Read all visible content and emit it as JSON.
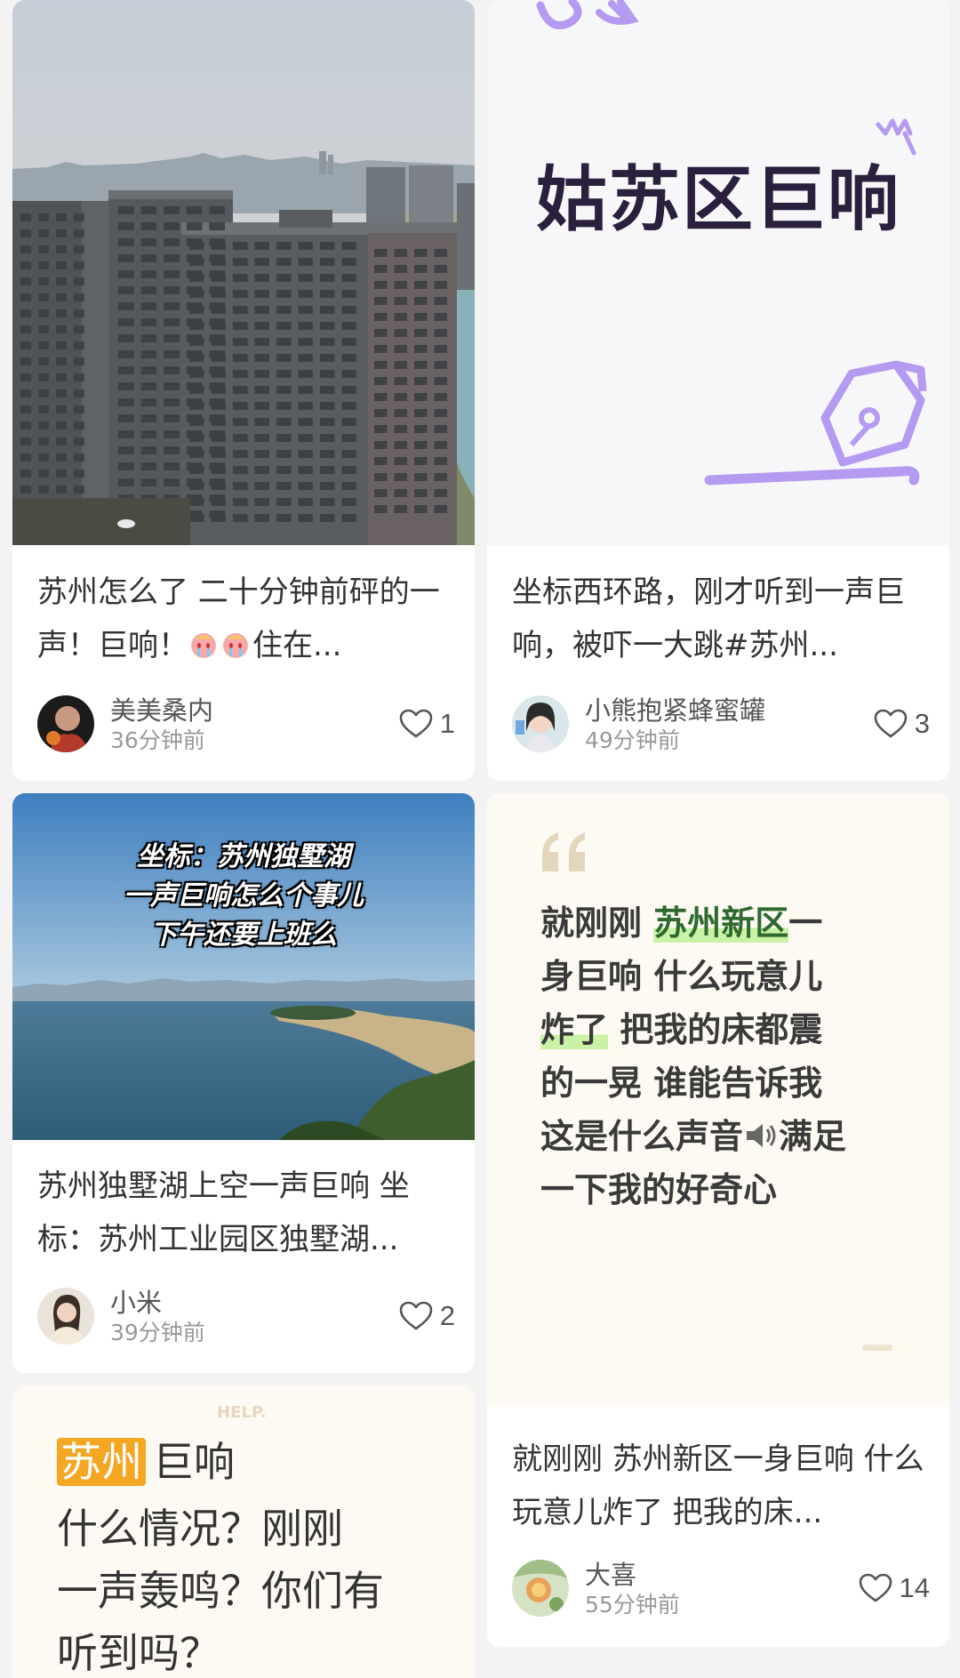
{
  "feed": [
    {
      "cover_kind": "photo-buildings",
      "caption_before": "苏州怎么了 二十分钟前砰的一声！巨响！",
      "caption_after": "住在...",
      "author": "美美桑内",
      "time": "36分钟前",
      "likes": "1"
    },
    {
      "cover_kind": "graphic-title",
      "cover_title": "姑苏区巨响",
      "caption": "坐标西环路，刚才听到一声巨响，被吓一大跳#苏州...",
      "author": "小熊抱紧蜂蜜罐",
      "time": "49分钟前",
      "likes": "3"
    },
    {
      "cover_kind": "photo-lake",
      "cover_lines": [
        "坐标：苏州独墅湖",
        "一声巨响怎么个事儿",
        "下午还要上班么"
      ],
      "caption": "苏州独墅湖上空一声巨响 坐标：苏州工业园区独墅湖...",
      "author": "小米",
      "time": "39分钟前",
      "likes": "2"
    },
    {
      "cover_kind": "text-quote",
      "quote_lines": [
        {
          "pre": "就刚刚 ",
          "mark": "苏州新区",
          "post": "一"
        },
        {
          "pre": "身巨响 什么玩意儿",
          "mark": "",
          "post": ""
        },
        {
          "pre": "",
          "mark": "炸了",
          "post": " 把我的床都震"
        },
        {
          "pre": "的一晃 谁能告诉我",
          "mark": "",
          "post": ""
        },
        {
          "pre": "这是什么声音",
          "mark": "",
          "post": "满足",
          "speaker": true
        },
        {
          "pre": "一下我的好奇心",
          "mark": "",
          "post": ""
        }
      ],
      "caption": "就刚刚 苏州新区一身巨响 什么玩意儿炸了 把我的床...",
      "author": "大喜",
      "time": "55分钟前",
      "likes": "14"
    },
    {
      "cover_kind": "text-help",
      "help_tag": "HELP.",
      "title_mark": "苏州",
      "title_rest": "巨响",
      "body_lines": [
        "什么情况？刚刚",
        "一声轰鸣？你们有",
        "听到吗？"
      ]
    }
  ],
  "colors": {
    "purple": "#b49af0",
    "title_dark": "#2a1f3d",
    "quote_tan": "#e4d6bc",
    "green_highlight": "#c9f2a6",
    "orange_highlight": "#f5a623"
  }
}
